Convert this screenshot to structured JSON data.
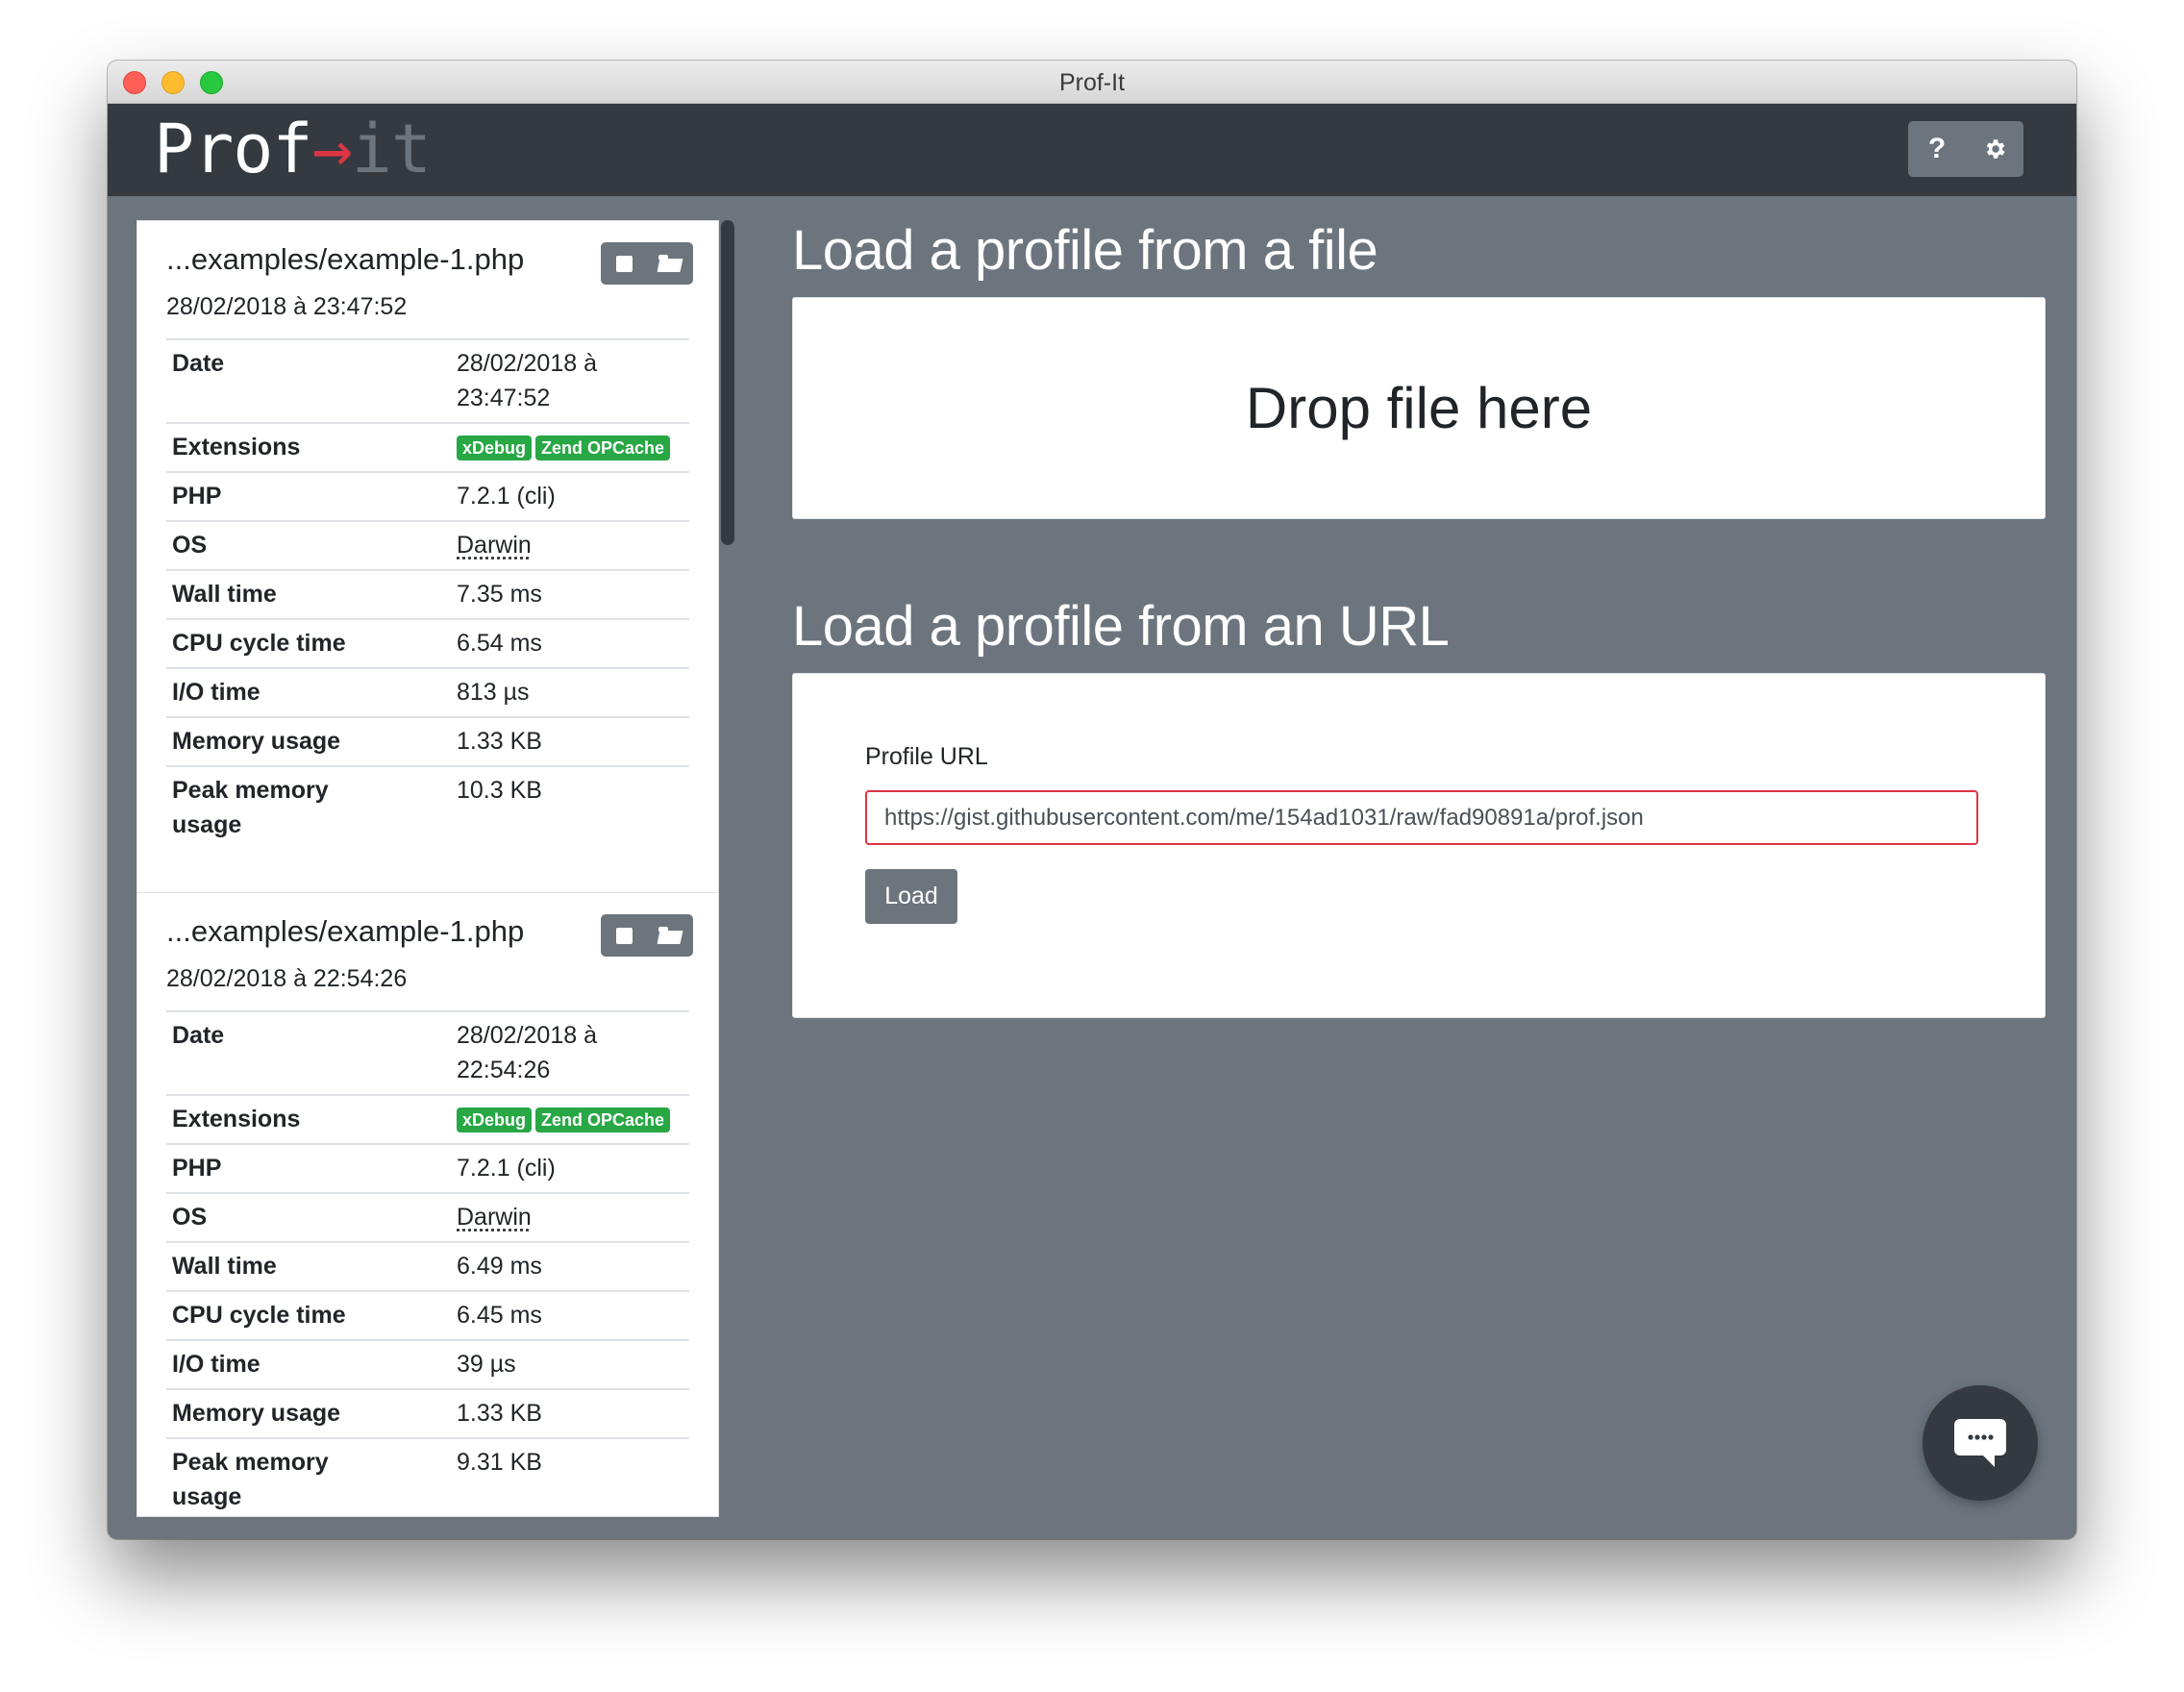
{
  "window": {
    "title": "Prof-It"
  },
  "navbar": {
    "logo": {
      "prefix": "Prof",
      "arrow": "→",
      "suffix": "it"
    },
    "help_label": "?",
    "help_icon": "question-icon",
    "settings_icon": "gear-icon"
  },
  "sidebar": {
    "profiles": [
      {
        "title": "...examples/example-1.php",
        "date": "28/02/2018 à 23:47:52",
        "rows": {
          "date_label": "Date",
          "date_value": "28/02/2018 à 23:47:52",
          "extensions_label": "Extensions",
          "extensions": [
            "xDebug",
            "Zend OPCache"
          ],
          "php_label": "PHP",
          "php_value": "7.2.1 (cli)",
          "os_label": "OS",
          "os_value": "Darwin",
          "wall_label": "Wall time",
          "wall_value": "7.35 ms",
          "cpu_label": "CPU cycle time",
          "cpu_value": "6.54 ms",
          "io_label": "I/O time",
          "io_value": "813 µs",
          "mem_label": "Memory usage",
          "mem_value": "1.33 KB",
          "peak_label": "Peak memory usage",
          "peak_value": "10.3 KB"
        }
      },
      {
        "title": "...examples/example-1.php",
        "date": "28/02/2018 à 22:54:26",
        "rows": {
          "date_label": "Date",
          "date_value": "28/02/2018 à 22:54:26",
          "extensions_label": "Extensions",
          "extensions": [
            "xDebug",
            "Zend OPCache"
          ],
          "php_label": "PHP",
          "php_value": "7.2.1 (cli)",
          "os_label": "OS",
          "os_value": "Darwin",
          "wall_label": "Wall time",
          "wall_value": "6.49 ms",
          "cpu_label": "CPU cycle time",
          "cpu_value": "6.45 ms",
          "io_label": "I/O time",
          "io_value": "39 µs",
          "mem_label": "Memory usage",
          "mem_value": "1.33 KB",
          "peak_label": "Peak memory usage",
          "peak_value": "9.31 KB"
        }
      }
    ]
  },
  "main": {
    "file_section": {
      "title": "Load a profile from a file",
      "dropzone_label": "Drop file here"
    },
    "url_section": {
      "title": "Load a profile from an URL",
      "field_label": "Profile URL",
      "field_value": "https://gist.githubusercontent.com/me/154ad1031/raw/fad90891a/prof.json",
      "load_label": "Load"
    }
  },
  "colors": {
    "navbar": "#343a40",
    "background": "#6c757d",
    "badge": "#28a745",
    "accent_red": "#dc3545"
  }
}
